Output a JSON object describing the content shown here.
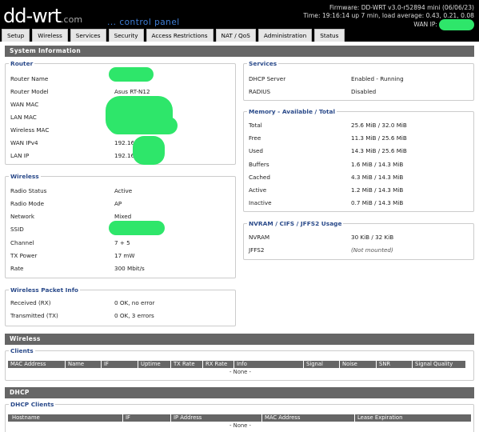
{
  "header": {
    "logo": "dd-wrt",
    "logo_suffix": ".com",
    "tagline": "... control panel",
    "firmware": "Firmware: DD-WRT v3.0-r52894 mini (06/06/23)",
    "uptime": "Time: 19:16:14 up 7 min, load average: 0.43, 0.21, 0.08",
    "wan_ip_label": "WAN IP:"
  },
  "tabs": [
    "Setup",
    "Wireless",
    "Services",
    "Security",
    "Access Restrictions",
    "NAT / QoS",
    "Administration",
    "Status"
  ],
  "system_info": {
    "title": "System Information",
    "router": {
      "legend": "Router",
      "rows": [
        {
          "label": "Router Name",
          "value": ""
        },
        {
          "label": "Router Model",
          "value": "Asus RT-N12"
        },
        {
          "label": "WAN MAC",
          "value": ""
        },
        {
          "label": "LAN MAC",
          "value": ""
        },
        {
          "label": "Wireless MAC",
          "value": ""
        },
        {
          "label": "WAN IPv4",
          "value": "192.168."
        },
        {
          "label": "LAN IP",
          "value": "192.168."
        }
      ]
    },
    "wireless": {
      "legend": "Wireless",
      "rows": [
        {
          "label": "Radio Status",
          "value": "Active"
        },
        {
          "label": "Radio Mode",
          "value": "AP"
        },
        {
          "label": "Network",
          "value": "Mixed"
        },
        {
          "label": "SSID",
          "value": ""
        },
        {
          "label": "Channel",
          "value": "7 + 5"
        },
        {
          "label": "TX Power",
          "value": "17 mW"
        },
        {
          "label": "Rate",
          "value": "300 Mbit/s"
        }
      ]
    },
    "packet_info": {
      "legend": "Wireless Packet Info",
      "rows": [
        {
          "label": "Received (RX)",
          "value": "0 OK, no error"
        },
        {
          "label": "Transmitted (TX)",
          "value": "0 OK, 3 errors"
        }
      ]
    },
    "services": {
      "legend": "Services",
      "rows": [
        {
          "label": "DHCP Server",
          "value": "Enabled - Running"
        },
        {
          "label": "RADIUS",
          "value": "Disabled"
        }
      ]
    },
    "memory": {
      "legend": "Memory - Available / Total",
      "rows": [
        {
          "label": "Total",
          "value": "25.6 MiB / 32.0 MiB"
        },
        {
          "label": "Free",
          "value": "11.3 MiB / 25.6 MiB"
        },
        {
          "label": "Used",
          "value": "14.3 MiB / 25.6 MiB"
        },
        {
          "label": "Buffers",
          "value": "1.6 MiB / 14.3 MiB"
        },
        {
          "label": "Cached",
          "value": "4.3 MiB / 14.3 MiB"
        },
        {
          "label": "Active",
          "value": "1.2 MiB / 14.3 MiB"
        },
        {
          "label": "Inactive",
          "value": "0.7 MiB / 14.3 MiB"
        }
      ]
    },
    "nvram": {
      "legend": "NVRAM / CIFS / JFFS2 Usage",
      "rows": [
        {
          "label": "NVRAM",
          "value": "30 KiB / 32 KiB"
        },
        {
          "label": "JFFS2",
          "value": "(Not mounted)"
        }
      ]
    }
  },
  "wireless_section": {
    "title": "Wireless",
    "clients_legend": "Clients",
    "columns": [
      "MAC Address",
      "Name",
      "IF",
      "Uptime",
      "TX Rate",
      "RX Rate",
      "Info",
      "Signal",
      "Noise",
      "SNR",
      "Signal Quality"
    ],
    "none_text": "- None -"
  },
  "dhcp_section": {
    "title": "DHCP",
    "clients_legend": "DHCP Clients",
    "columns": [
      "Hostname",
      "IF",
      "IP Address",
      "MAC Address",
      "Lease Expiration"
    ],
    "none_text": "- None -"
  },
  "colors": {
    "header_bg": "#000000",
    "section_bar": "#666666",
    "legend_text": "#2a4a8a",
    "redaction": "#2ee66a"
  }
}
